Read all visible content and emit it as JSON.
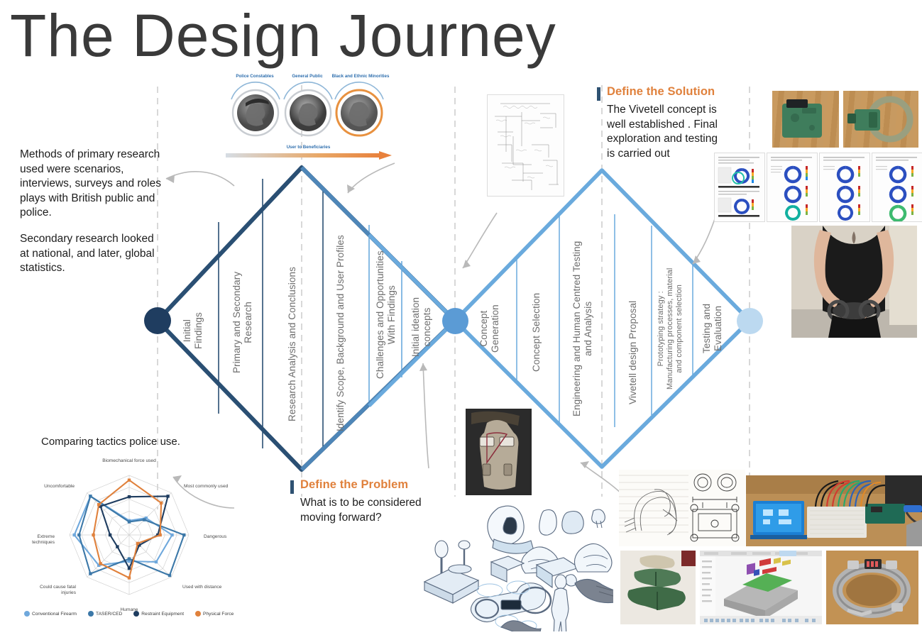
{
  "title": "The Design Journey",
  "research_note": {
    "p1": "Methods of primary research used were scenarios, interviews, surveys and roles plays with British public and police.",
    "p2": "Secondary research looked at national, and later, global statistics."
  },
  "callouts": {
    "solution": {
      "title": "Define the Solution",
      "body": "The Vivetell concept is well established . Final exploration and testing is carried out"
    },
    "problem": {
      "title": "Define the Problem",
      "body": "What is to be considered moving forward?"
    }
  },
  "personas": {
    "items": [
      {
        "label": "Police Constables",
        "ring": "#c9ccd1"
      },
      {
        "label": "General Public",
        "ring": "#b9bec4"
      },
      {
        "label": "Black and Ethnic Minorities",
        "ring": "#e8913f"
      }
    ],
    "arrow_label": "User to Beneficiaries"
  },
  "diamond1": {
    "stroke": "#2a4f73",
    "node_start_color": "#1f3d60",
    "node_mid_color": "#5b9bd5",
    "segments": [
      {
        "label": "Initial\nFindings"
      },
      {
        "label": "Primary and Secondary\nResearch"
      },
      {
        "label": "Research Analysis and Conclusions"
      },
      {
        "label": "Identify Scope, Background and User Profiles"
      },
      {
        "label": "Challenges and Opportunities\nWith Findings"
      },
      {
        "label": "Initial ideation\nconcepts"
      }
    ]
  },
  "diamond2": {
    "stroke": "#6aaadd",
    "node_end_color": "#bcd9f0",
    "segments": [
      {
        "label": "Concept\nGeneration"
      },
      {
        "label": "Concept Selection"
      },
      {
        "label": "Engineering and Human Centred Testing\nand Analysis"
      },
      {
        "label": "Vivetell design Proposal"
      },
      {
        "label": "Prototyping strategy :\nManufacturing processes, material\nand component selection"
      },
      {
        "label": "Testing and\nEvaluation"
      }
    ]
  },
  "chart_data": {
    "type": "radar",
    "title": "Comparing tactics police use.",
    "categories": [
      "Biomechanical force used",
      "Most commonly used",
      "Dangerous",
      "Used with distance",
      "Humane",
      "Could cause  fatal injuries",
      "Extreme techniques",
      "Uncomfortable"
    ],
    "rmax": 5,
    "grid": true,
    "legend_position": "bottom",
    "series": [
      {
        "name": "Conventional Firearm",
        "color": "#6fa8dc",
        "values": [
          1.2,
          2.0,
          3.6,
          3.2,
          2.2,
          3.6,
          4.6,
          4.6
        ]
      },
      {
        "name": "TASER/CED",
        "color": "#3c78a8",
        "values": [
          1.1,
          1.8,
          4.6,
          4.8,
          2.0,
          4.6,
          4.2,
          4.6
        ]
      },
      {
        "name": "Restraint Equipment",
        "color": "#1f3d60",
        "values": [
          3.2,
          4.6,
          2.4,
          1.2,
          2.8,
          1.4,
          1.6,
          3.4
        ]
      },
      {
        "name": "Physical Force",
        "color": "#e0813c",
        "values": [
          4.6,
          3.8,
          2.6,
          1.0,
          3.6,
          3.4,
          3.0,
          3.6
        ]
      }
    ]
  },
  "media": {
    "mindmap": "hand-drawn-scamper-mind-map",
    "solution_photos": [
      "green-3d-printed-electronics-housing",
      "metal-cuff-ring-with-pcb"
    ],
    "fea_sheets": [
      "fea-report-page-1",
      "fea-report-page-2",
      "fea-report-page-3",
      "fea-report-page-4"
    ],
    "user_test_photo": "person-wearing-restraint-cuffs-behind-back",
    "torso_prototype": "mannequin-torso-harness-prototype",
    "concept_sketches": "ideation-concept-sketch-sheet",
    "cad_sketch": "engineering-drawing-and-sketch",
    "electronics_photo": "arduino-breadboard-lcd-prototype",
    "foam_models": "green-foam-ergonomic-models",
    "cad_screen": "cad-assembly-screenshot",
    "metal_prototype": "welded-metal-cuff-prototype"
  }
}
